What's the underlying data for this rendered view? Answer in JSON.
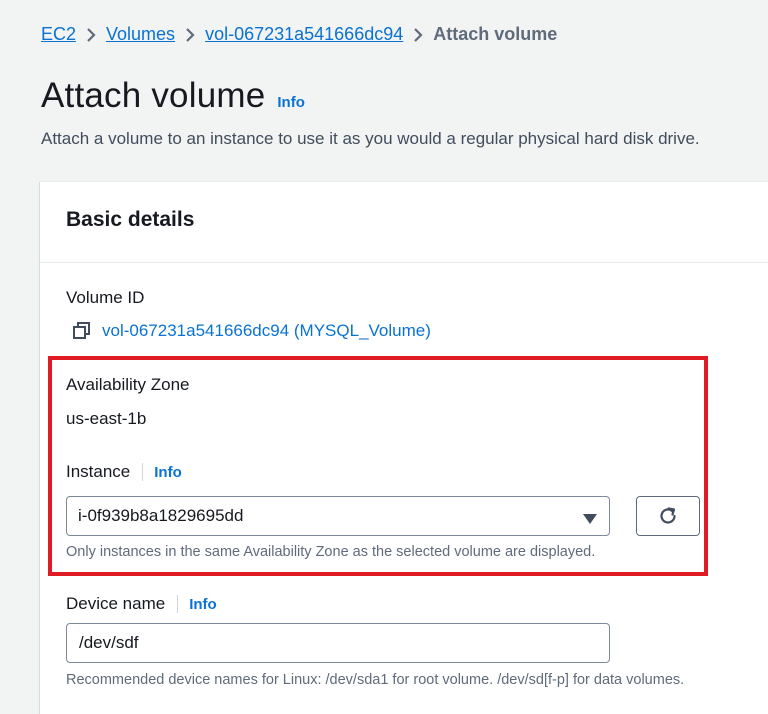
{
  "breadcrumb": {
    "items": [
      "EC2",
      "Volumes",
      "vol-067231a541666dc94"
    ],
    "current": "Attach volume"
  },
  "page": {
    "title": "Attach volume",
    "info_label": "Info",
    "description": "Attach a volume to an instance to use it as you would a regular physical hard disk drive."
  },
  "basic_details": {
    "title": "Basic details",
    "volume_id_label": "Volume ID",
    "volume_id_value": "vol-067231a541666dc94 (MYSQL_Volume)",
    "az_label": "Availability Zone",
    "az_value": "us-east-1b",
    "instance_label": "Instance",
    "instance_info": "Info",
    "instance_value": "i-0f939b8a1829695dd",
    "instance_hint": "Only instances in the same Availability Zone as the selected volume are displayed.",
    "device_label": "Device name",
    "device_info": "Info",
    "device_value": "/dev/sdf",
    "device_hint": "Recommended device names for Linux: /dev/sda1 for root volume. /dev/sd[f-p] for data volumes."
  },
  "icons": {
    "copy": "copy-icon",
    "caret": "caret-down-icon",
    "refresh": "refresh-icon",
    "chevron": "chevron-right-icon"
  },
  "colors": {
    "link": "#0972d3",
    "highlight": "#e01b24",
    "background": "#f2f3f3"
  }
}
